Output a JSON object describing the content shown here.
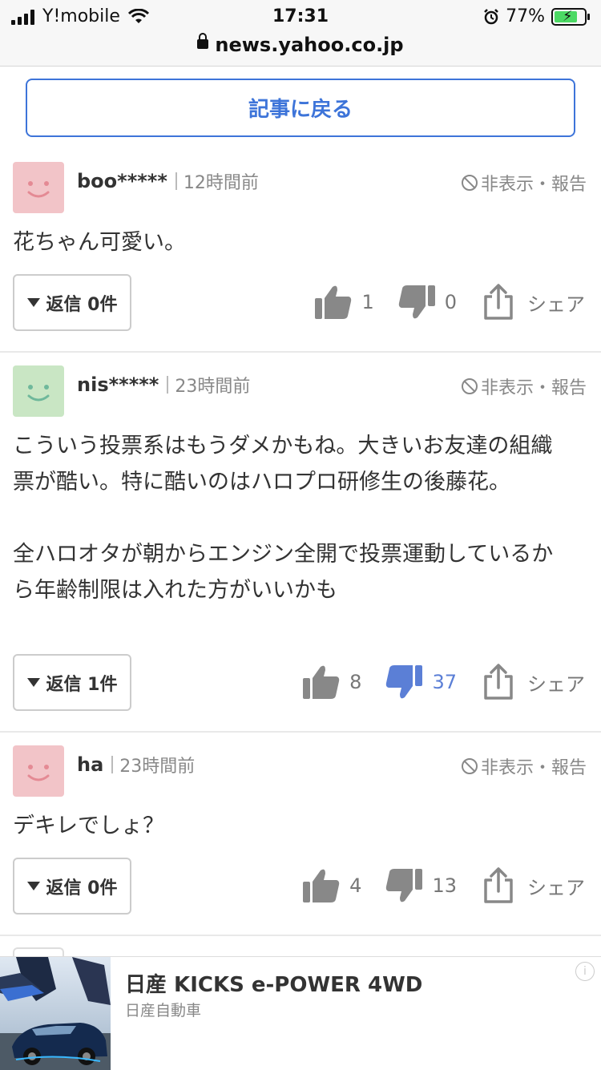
{
  "status_bar": {
    "carrier": "Y!mobile",
    "time": "17:31",
    "battery": "77%",
    "battery_level": 0.77,
    "url": "news.yahoo.co.jp"
  },
  "back_button": {
    "label": "記事に戻る"
  },
  "comment_actions": {
    "hide_report": "非表示・報告",
    "share": "シェア"
  },
  "comments": [
    {
      "user": "boo*****",
      "time": "12時間前",
      "text": "花ちゃん可愛い。",
      "reply": "返信 0件",
      "likes": "1",
      "dislikes": "0",
      "avatar_color": "#f2c4c8"
    },
    {
      "user": "nis*****",
      "time": "23時間前",
      "text": "こういう投票系はもうダメかもね。大きいお友達の組織票が酷い。特に酷いのはハロプロ研修生の後藤花。\n\n全ハロオタが朝からエンジン全開で投票運動しているから年齢制限は入れた方がいいかも",
      "reply": "返信 1件",
      "likes": "8",
      "dislikes": "37",
      "avatar_color": "#c9e6c4"
    },
    {
      "user": "ha",
      "time": "23時間前",
      "text": "デキレでしょ？",
      "reply": "返信 0件",
      "likes": "4",
      "dislikes": "13",
      "avatar_color": "#f2c4c8"
    }
  ],
  "ad": {
    "title": "日産 KICKS e-POWER 4WD",
    "sponsor": "日産自動車"
  },
  "colors": {
    "accent": "#3d74d9",
    "icon_gray": "#888888",
    "dislike_active": "#5b7fd6"
  }
}
